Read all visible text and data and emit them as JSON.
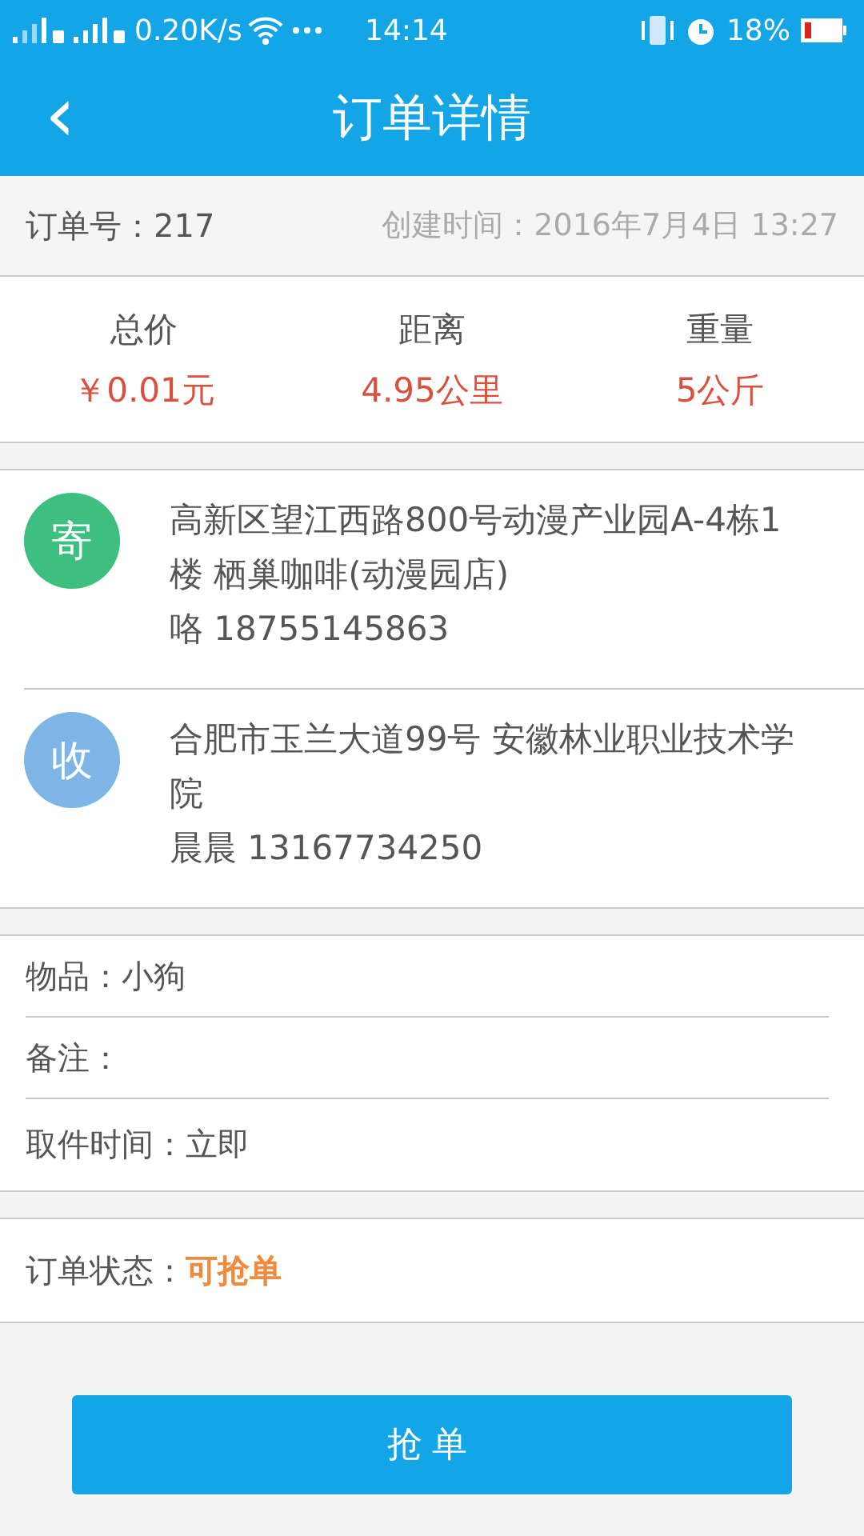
{
  "status_bar": {
    "speed": "0.20K/s",
    "time": "14:14",
    "battery": "18%"
  },
  "header": {
    "back": "‹",
    "title": "订单详情"
  },
  "order": {
    "number_label": "订单号：217",
    "created_label": "创建时间：2016年7月4日 13:27"
  },
  "stats": [
    {
      "label": "总价",
      "value": "￥0.01元"
    },
    {
      "label": "距离",
      "value": "4.95公里"
    },
    {
      "label": "重量",
      "value": "5公斤"
    }
  ],
  "addresses": [
    {
      "badge": "寄",
      "color": "#3dbf7f",
      "address": "高新区望江西路800号动漫产业园A-4栋1楼 栖巢咖啡(动漫园店)",
      "contact": "咯 18755145863"
    },
    {
      "badge": "收",
      "color": "#7db5e6",
      "address": "合肥市玉兰大道99号 安徽林业职业技术学院",
      "contact": "晨晨 13167734250"
    }
  ],
  "details": [
    {
      "text": "物品：小狗"
    },
    {
      "text": "备注："
    },
    {
      "text": "取件时间：立即"
    }
  ],
  "order_status": {
    "label": "订单状态：",
    "value": "可抢单"
  },
  "action": {
    "label": "抢单"
  }
}
